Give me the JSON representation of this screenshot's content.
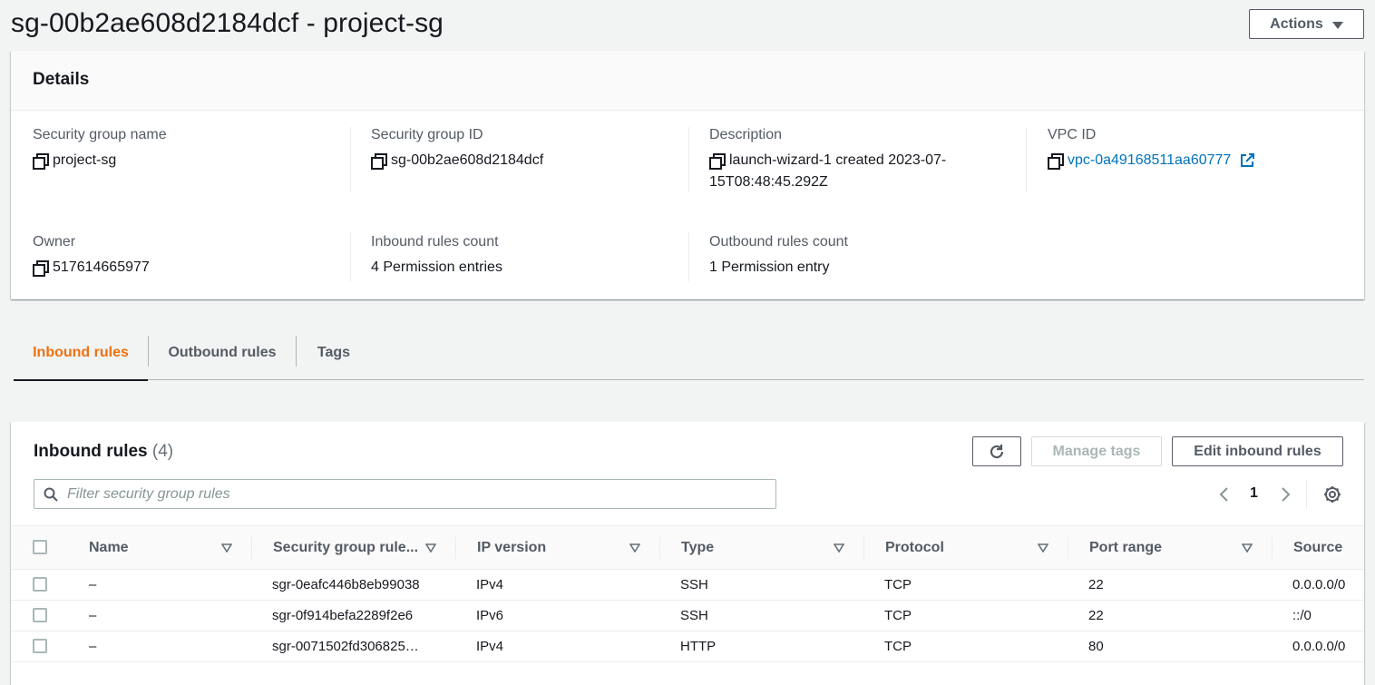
{
  "header": {
    "title": "sg-00b2ae608d2184dcf - project-sg",
    "actions_label": "Actions"
  },
  "details": {
    "title": "Details",
    "fields": {
      "sg_name": {
        "label": "Security group name",
        "value": "project-sg"
      },
      "sg_id": {
        "label": "Security group ID",
        "value": "sg-00b2ae608d2184dcf"
      },
      "description": {
        "label": "Description",
        "value_line1": "launch-wizard-1 created 2023-07-",
        "value_line2": "15T08:48:45.292Z"
      },
      "vpc_id": {
        "label": "VPC ID",
        "value": "vpc-0a49168511aa60777"
      },
      "owner": {
        "label": "Owner",
        "value": "517614665977"
      },
      "inbound_count": {
        "label": "Inbound rules count",
        "value": "4 Permission entries"
      },
      "outbound_count": {
        "label": "Outbound rules count",
        "value": "1 Permission entry"
      }
    }
  },
  "tabs": {
    "inbound": "Inbound rules",
    "outbound": "Outbound rules",
    "tags": "Tags"
  },
  "rules": {
    "title": "Inbound rules",
    "count": "(4)",
    "manage_tags_label": "Manage tags",
    "edit_label": "Edit inbound rules",
    "filter_placeholder": "Filter security group rules",
    "page_number": "1",
    "columns": {
      "name": "Name",
      "rule_id": "Security group rule...",
      "ip_version": "IP version",
      "type": "Type",
      "protocol": "Protocol",
      "port_range": "Port range",
      "source": "Source"
    },
    "rows": [
      {
        "name": "–",
        "rule_id": "sgr-0eafc446b8eb99038",
        "ip_version": "IPv4",
        "type": "SSH",
        "protocol": "TCP",
        "port_range": "22",
        "source": "0.0.0.0/0"
      },
      {
        "name": "–",
        "rule_id": "sgr-0f914befa2289f2e6",
        "ip_version": "IPv6",
        "type": "SSH",
        "protocol": "TCP",
        "port_range": "22",
        "source": "::/0"
      },
      {
        "name": "–",
        "rule_id": "sgr-0071502fd306825…",
        "ip_version": "IPv4",
        "type": "HTTP",
        "protocol": "TCP",
        "port_range": "80",
        "source": "0.0.0.0/0"
      }
    ]
  },
  "colors": {
    "accent_orange": "#ec7211",
    "link_blue": "#0073bb",
    "text": "#16191f",
    "muted": "#545b64"
  },
  "icons": [
    "copy-icon",
    "external-link-icon",
    "refresh-icon",
    "search-icon",
    "chevron-left-icon",
    "chevron-right-icon",
    "settings-gear-icon",
    "sort-caret-icon",
    "caret-down-icon"
  ]
}
